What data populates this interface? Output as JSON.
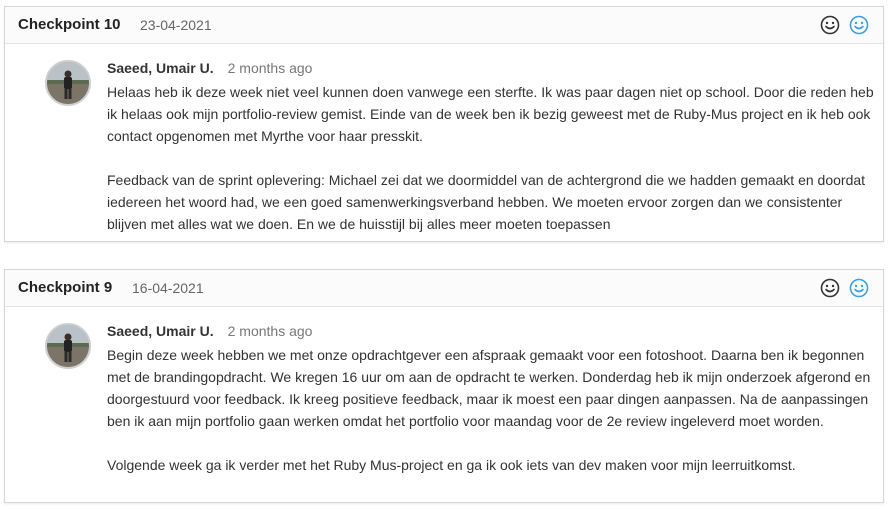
{
  "checkpoints": [
    {
      "title": "Checkpoint 10",
      "date": "23-04-2021",
      "author": "Saeed, Umair U.",
      "time_ago": "2 months ago",
      "paragraphs": [
        "Helaas heb ik deze week niet veel kunnen doen vanwege een sterfte. Ik was paar dagen niet op school. Door die reden heb ik helaas ook mijn portfolio-review gemist. Einde van de week ben ik bezig geweest met de Ruby-Mus project en ik heb ook contact opgenomen met Myrthe voor haar presskit.",
        "Feedback van de sprint oplevering: Michael zei dat we doormiddel van de achtergrond die we hadden gemaakt en doordat iedereen het woord had, we een goed samenwerkingsverband hebben. We moeten ervoor zorgen dan we consistenter blijven met alles wat we doen. En we de huisstijl bij alles meer moeten toepassen"
      ],
      "icons": [
        "smiley-outline-icon",
        "smiley-blue-icon"
      ]
    },
    {
      "title": "Checkpoint 9",
      "date": "16-04-2021",
      "author": "Saeed, Umair U.",
      "time_ago": "2 months ago",
      "paragraphs": [
        "Begin deze week hebben we met onze opdrachtgever een afspraak gemaakt voor een fotoshoot. Daarna ben ik begonnen met de brandingopdracht. We kregen 16 uur om aan de opdracht te werken. Donderdag heb ik mijn onderzoek afgerond en doorgestuurd voor feedback. Ik kreeg positieve feedback, maar ik moest een paar dingen aanpassen. Na de aanpassingen ben ik aan mijn portfolio gaan werken omdat het portfolio voor maandag voor de 2e review ingeleverd moet worden.",
        "Volgende week ga ik verder met het Ruby Mus-project en ga ik ook iets van dev maken voor mijn leerruitkomst."
      ],
      "icons": [
        "smiley-outline-icon",
        "smiley-blue-icon"
      ]
    }
  ],
  "colors": {
    "icon_dark": "#333333",
    "icon_blue": "#3aa0e0",
    "border": "#d6d6d6"
  }
}
